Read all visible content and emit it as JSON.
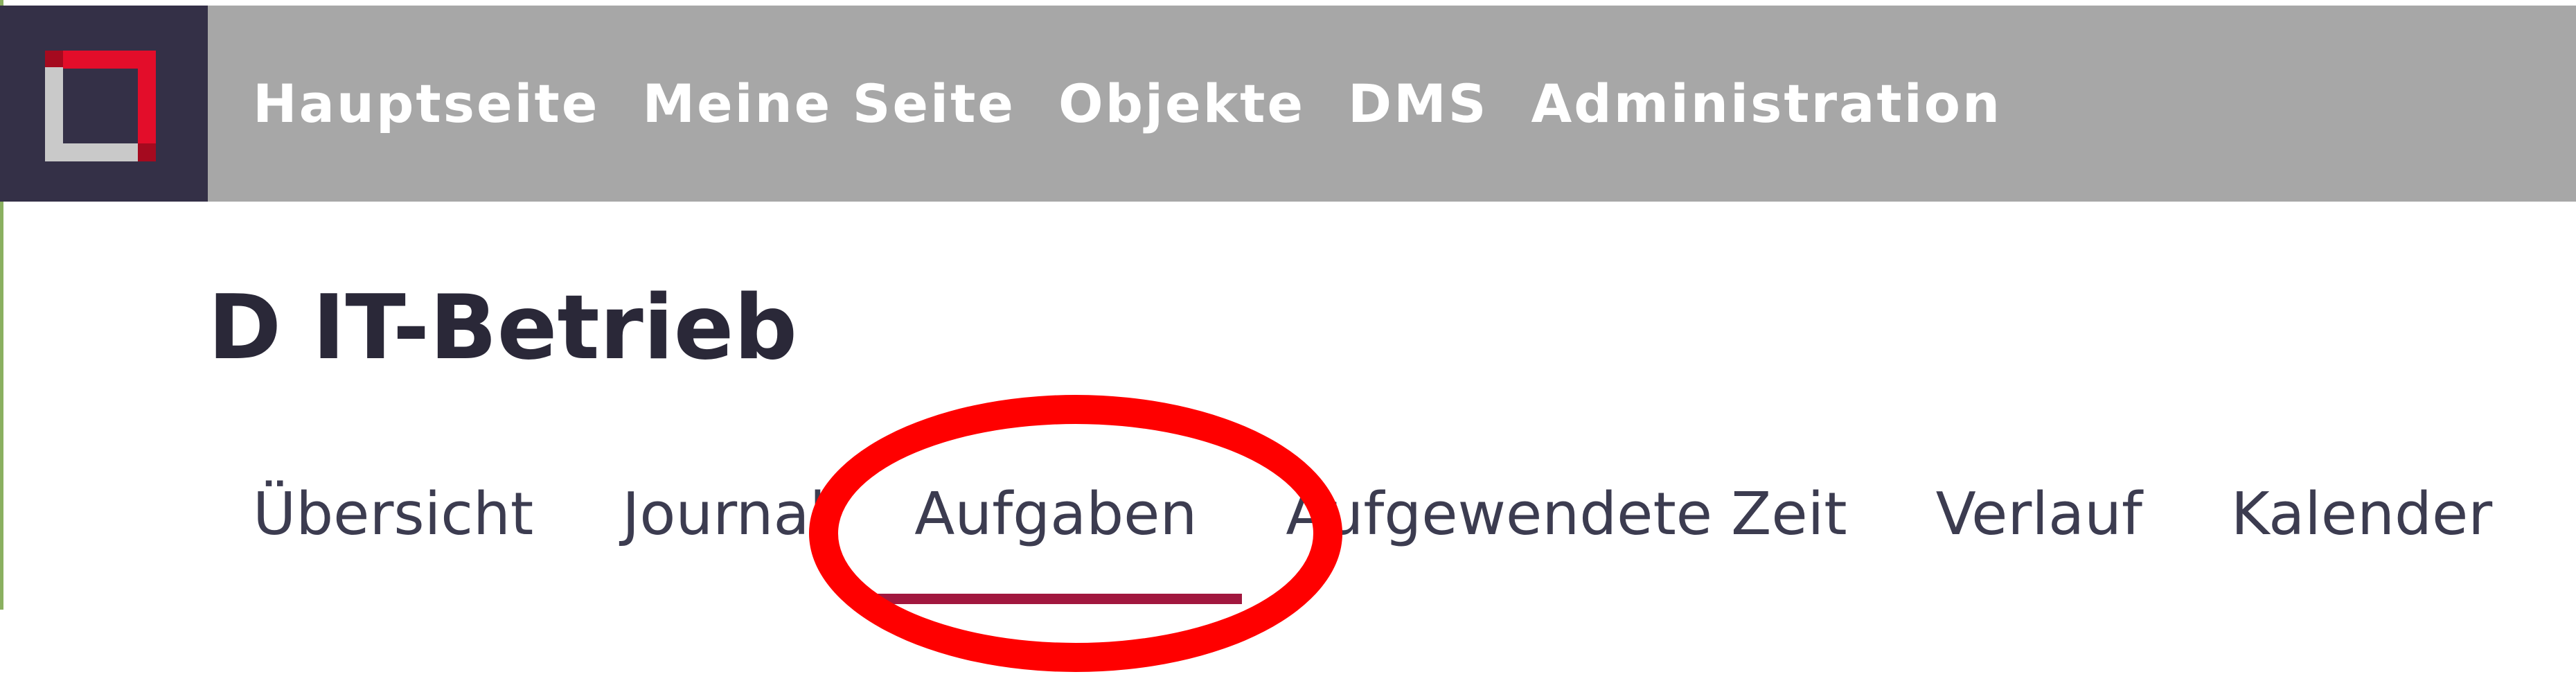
{
  "topnav": {
    "items": [
      {
        "label": "Hauptseite"
      },
      {
        "label": "Meine Seite"
      },
      {
        "label": "Objekte"
      },
      {
        "label": "DMS"
      },
      {
        "label": "Administration"
      }
    ]
  },
  "project": {
    "title": "D IT-Betrieb"
  },
  "tabs": {
    "selected": "Aufgaben",
    "items": [
      {
        "label": "Übersicht"
      },
      {
        "label": "Journal"
      },
      {
        "label": "Aufgaben"
      },
      {
        "label": "Aufgewendete Zeit"
      },
      {
        "label": "Verlauf"
      },
      {
        "label": "Kalender"
      }
    ]
  },
  "colors": {
    "topbar": "#a7a7a7",
    "logo_background": "#343047",
    "tab_underline": "#a1173e",
    "annotation": "#ff0000"
  },
  "icons": {
    "logo": "app-logo-icon"
  }
}
